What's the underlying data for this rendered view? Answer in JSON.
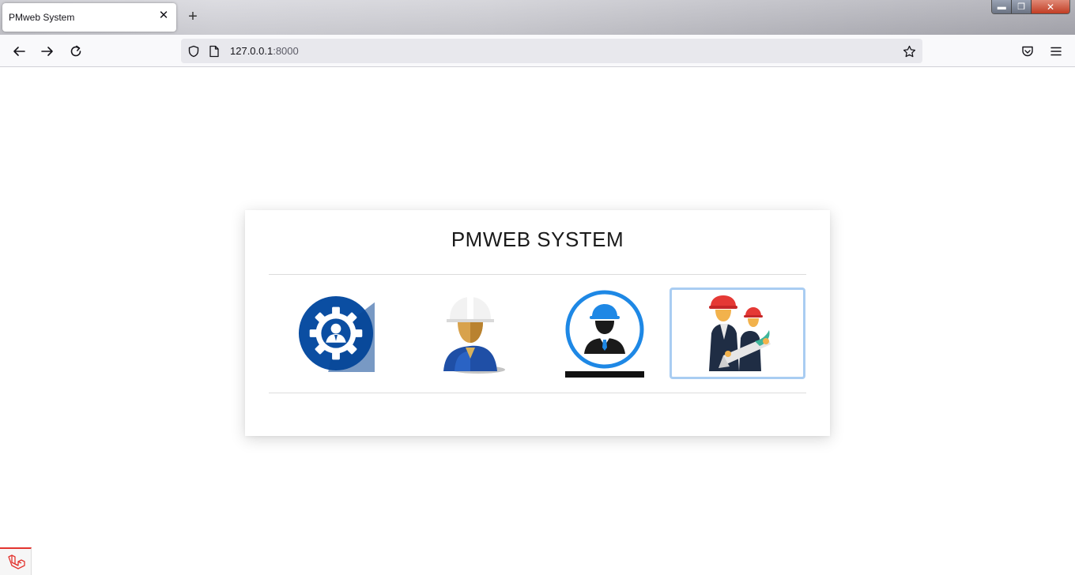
{
  "browser": {
    "tab_title": "PMweb System",
    "tab_close_glyph": "✕",
    "new_tab_glyph": "+",
    "url_host": "127.0.0.1",
    "url_port": ":8000",
    "window_controls": {
      "minimize": "▬",
      "maximize": "❐",
      "close": "✕"
    },
    "icons": [
      "back-arrow-icon",
      "forward-arrow-icon",
      "reload-icon",
      "shield-icon",
      "page-icon",
      "star-icon",
      "pocket-icon",
      "hamburger-menu-icon"
    ]
  },
  "page": {
    "title": "PMWEB SYSTEM",
    "tiles": [
      {
        "icon": "admin-gear-icon",
        "selected": false
      },
      {
        "icon": "hardhat-worker-icon",
        "selected": false
      },
      {
        "icon": "engineer-circle-icon",
        "selected": false
      },
      {
        "icon": "engineers-blueprint-icon",
        "selected": true
      }
    ],
    "footer_icon": "laravel-logo-icon"
  },
  "colors": {
    "selected_border": "#a9cdf2",
    "gear_blue": "#0b4ea2",
    "circle_blue": "#1e88e5",
    "hardhat_red": "#e53935"
  }
}
